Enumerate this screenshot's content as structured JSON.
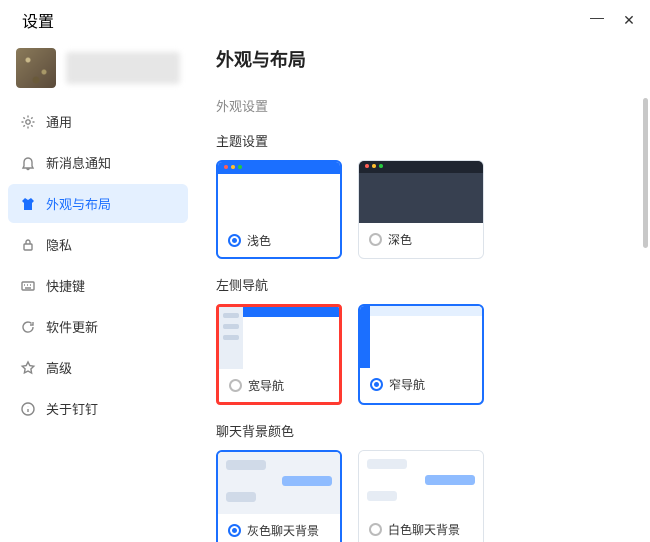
{
  "titlebar": {
    "title": "设置"
  },
  "sidebar": {
    "items": [
      {
        "label": "通用"
      },
      {
        "label": "新消息通知"
      },
      {
        "label": "外观与布局"
      },
      {
        "label": "隐私"
      },
      {
        "label": "快捷键"
      },
      {
        "label": "软件更新"
      },
      {
        "label": "高级"
      },
      {
        "label": "关于钉钉"
      }
    ]
  },
  "main": {
    "title": "外观与布局",
    "section_label": "外观设置",
    "theme": {
      "label": "主题设置",
      "options": [
        {
          "label": "浅色",
          "selected": true
        },
        {
          "label": "深色",
          "selected": false
        }
      ]
    },
    "leftnav": {
      "label": "左侧导航",
      "options": [
        {
          "label": "宽导航",
          "selected": false
        },
        {
          "label": "窄导航",
          "selected": true
        }
      ]
    },
    "chatbg": {
      "label": "聊天背景颜色",
      "options": [
        {
          "label": "灰色聊天背景",
          "selected": true
        },
        {
          "label": "白色聊天背景",
          "selected": false
        }
      ]
    }
  }
}
